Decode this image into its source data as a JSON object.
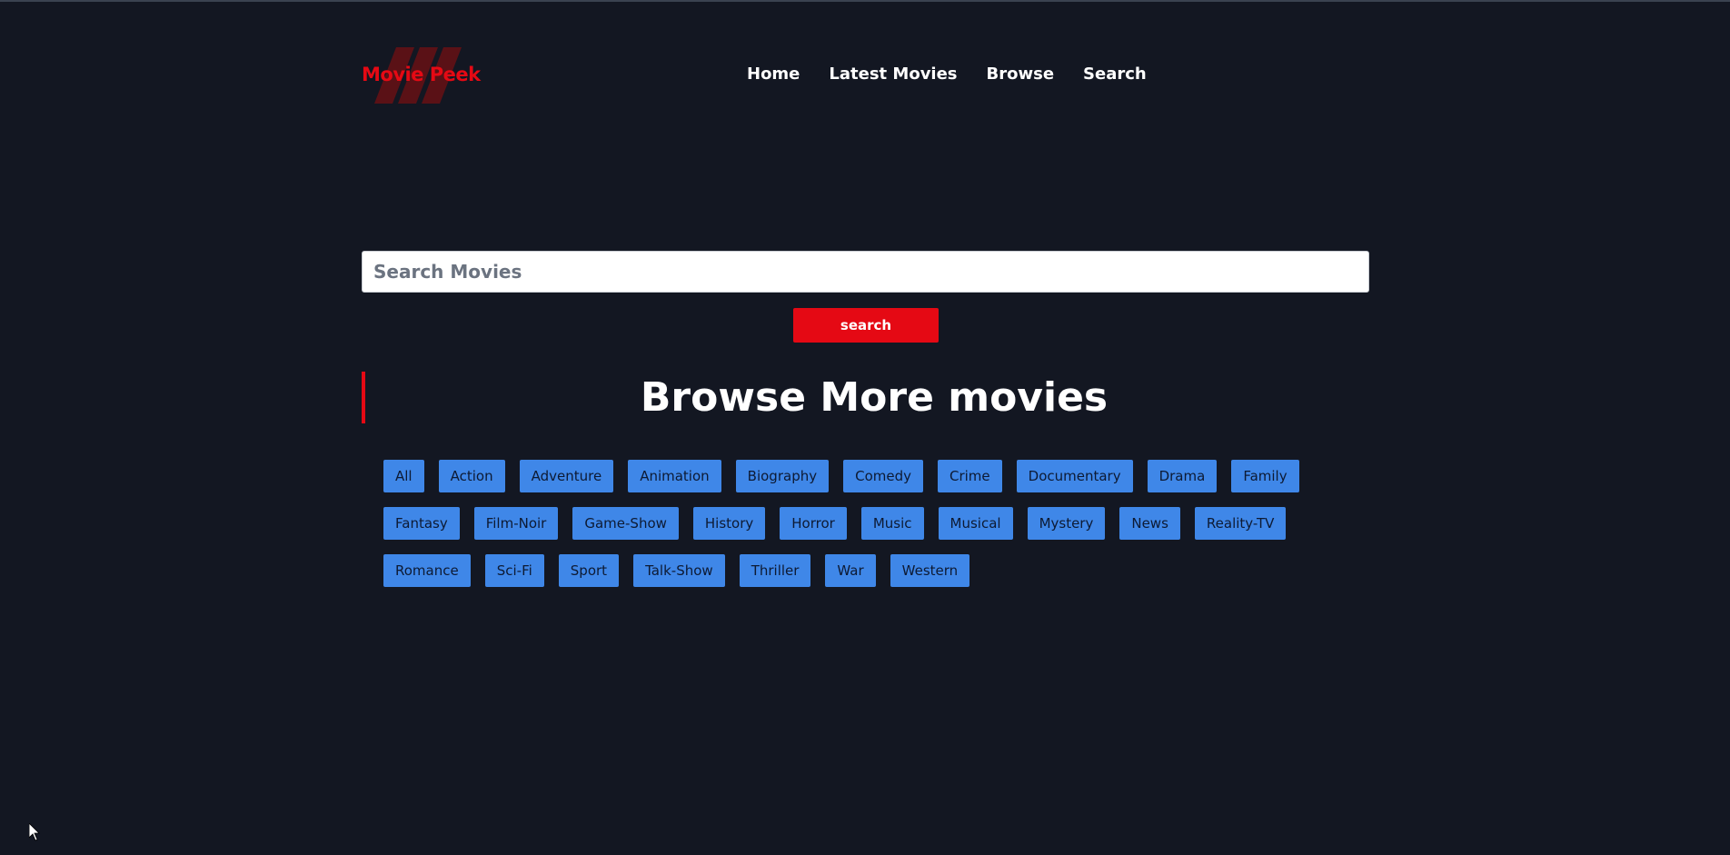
{
  "header": {
    "logo_text": "Movie Peek",
    "nav": [
      "Home",
      "Latest Movies",
      "Browse",
      "Search"
    ]
  },
  "search": {
    "placeholder": "Search Movies",
    "button_label": "search"
  },
  "browse": {
    "title": "Browse More movies",
    "genre_rows": [
      [
        "All",
        "Action",
        "Adventure",
        "Animation",
        "Biography",
        "Comedy",
        "Crime",
        "Documentary",
        "Drama",
        "Family"
      ],
      [
        "Fantasy",
        "Film-Noir",
        "Game-Show",
        "History",
        "Horror",
        "Music",
        "Musical",
        "Mystery",
        "News",
        "Reality-TV"
      ],
      [
        "Romance",
        "Sci-Fi",
        "Sport",
        "Talk-Show",
        "Thriller",
        "War",
        "Western"
      ]
    ]
  },
  "colors": {
    "background": "#131722",
    "accent": "#e50914",
    "genre_button": "#3f87e8"
  }
}
